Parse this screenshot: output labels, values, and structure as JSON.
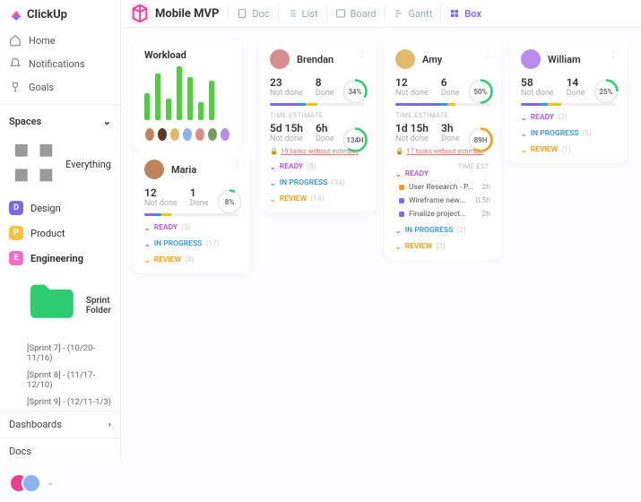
{
  "brand": "ClickUp",
  "nav": {
    "home": "Home",
    "notifications": "Notifications",
    "goals": "Goals"
  },
  "spaces": {
    "label": "Spaces",
    "everything": "Everything",
    "items": [
      {
        "letter": "D",
        "name": "Design",
        "color": "#7b68ee"
      },
      {
        "letter": "P",
        "name": "Product",
        "color": "#f5c542"
      },
      {
        "letter": "E",
        "name": "Engineering",
        "color": "#ff6bcb"
      }
    ],
    "folder": "Sprint Folder",
    "sprints": [
      "[Sprint 7] - (10/20-11/16)",
      "[Sprint 8] - (11/17-12/10)",
      "[Sprint 9] - (12/11-1/3)"
    ]
  },
  "bottom": {
    "dashboards": "Dashboards",
    "docs": "Docs"
  },
  "views": {
    "title": "Mobile MVP",
    "doc": "Doc",
    "list": "List",
    "board": "Board",
    "gantt": "Gantt",
    "box": "Box"
  },
  "workload": {
    "title": "Workload",
    "bars": [
      30,
      52,
      24,
      60,
      48,
      20,
      44
    ],
    "avcolors": [
      "#c0845c",
      "#5a3b2a",
      "#e2b96f",
      "#8bb3f0",
      "#d98c8c",
      "#7a9c62",
      "#b98cf0"
    ]
  },
  "people": [
    {
      "name": "Maria",
      "av": "#c0845c",
      "s1": {
        "a": {
          "n": "12",
          "l": "Not done"
        },
        "b": {
          "n": "1",
          "l": "Done"
        }
      },
      "ring1": "8%",
      "ring1c": "#2ecc71",
      "prog": [
        [
          "#7b68ee",
          12
        ],
        [
          "#3498db",
          6
        ],
        [
          "#f1c40f",
          10
        ]
      ],
      "sects": [
        [
          "ready",
          "READY",
          "(3)"
        ],
        [
          "prog-s",
          "IN PROGRESS",
          "(17)"
        ],
        [
          "rev",
          "REVIEW",
          "(8)"
        ]
      ]
    },
    {
      "name": "Brendan",
      "av": "#d98c8c",
      "s1": {
        "a": {
          "n": "23",
          "l": "Not done"
        },
        "b": {
          "n": "8",
          "l": "Done"
        }
      },
      "ring1": "34%",
      "ring1c": "#2ecc71",
      "te": "TIME ESTIMATE",
      "s2": {
        "a": {
          "n": "5d 15h",
          "l": "Not done"
        },
        "b": {
          "n": "6h",
          "l": "Done"
        }
      },
      "ring2": "134H",
      "ring2c": "#2ecc71",
      "warn": "19 tasks without estimate",
      "prog": [
        [
          "#7b68ee",
          30
        ],
        [
          "#3498db",
          8
        ],
        [
          "#f1c40f",
          12
        ]
      ],
      "sects": [
        [
          "ready",
          "READY",
          "(8)"
        ],
        [
          "prog-s",
          "IN PROGRESS",
          "(34)"
        ],
        [
          "rev",
          "REVIEW",
          "(14)"
        ]
      ]
    },
    {
      "name": "Amy",
      "av": "#e2b96f",
      "s1": {
        "a": {
          "n": "12",
          "l": "Not done"
        },
        "b": {
          "n": "6",
          "l": "Done"
        }
      },
      "ring1": "50%",
      "ring1c": "#2ecc71",
      "te": "TIME ESTIMATE",
      "s2": {
        "a": {
          "n": "1d 15h",
          "l": "Not done"
        },
        "b": {
          "n": "3h",
          "l": "Done"
        }
      },
      "ring2": "89H",
      "ring2c": "#f39c12",
      "warn": "17 tasks without estimate",
      "prog": [
        [
          "#7b68ee",
          45
        ],
        [
          "#3498db",
          10
        ],
        [
          "#f1c40f",
          8
        ]
      ],
      "sectlabels": {
        "ready": "READY",
        "te": "TIME EST."
      },
      "tasks": [
        {
          "c": "#f39c12",
          "n": "User Research - P...",
          "h": "2h"
        },
        {
          "c": "#7b68ee",
          "n": "Wireframe new...",
          "h": "0.5h"
        },
        {
          "c": "#7b68ee",
          "n": "Finalize project...",
          "h": "2h"
        }
      ],
      "sects2": [
        [
          "prog-s",
          "IN PROGRESS",
          "(2)"
        ],
        [
          "rev",
          "REVIEW",
          "(3)"
        ]
      ]
    },
    {
      "name": "William",
      "av": "#b98cf0",
      "s1": {
        "a": {
          "n": "58",
          "l": "Not done"
        },
        "b": {
          "n": "14",
          "l": "Done"
        }
      },
      "ring1": "25%",
      "ring1c": "#2ecc71",
      "prog": [
        [
          "#7b68ee",
          22
        ],
        [
          "#3498db",
          6
        ],
        [
          "#f1c40f",
          14
        ]
      ],
      "sects": [
        [
          "ready",
          "READY",
          "(2)"
        ],
        [
          "prog-s",
          "IN PROGRESS",
          "(5)"
        ],
        [
          "rev",
          "REVIEW",
          "(1)"
        ]
      ]
    }
  ]
}
